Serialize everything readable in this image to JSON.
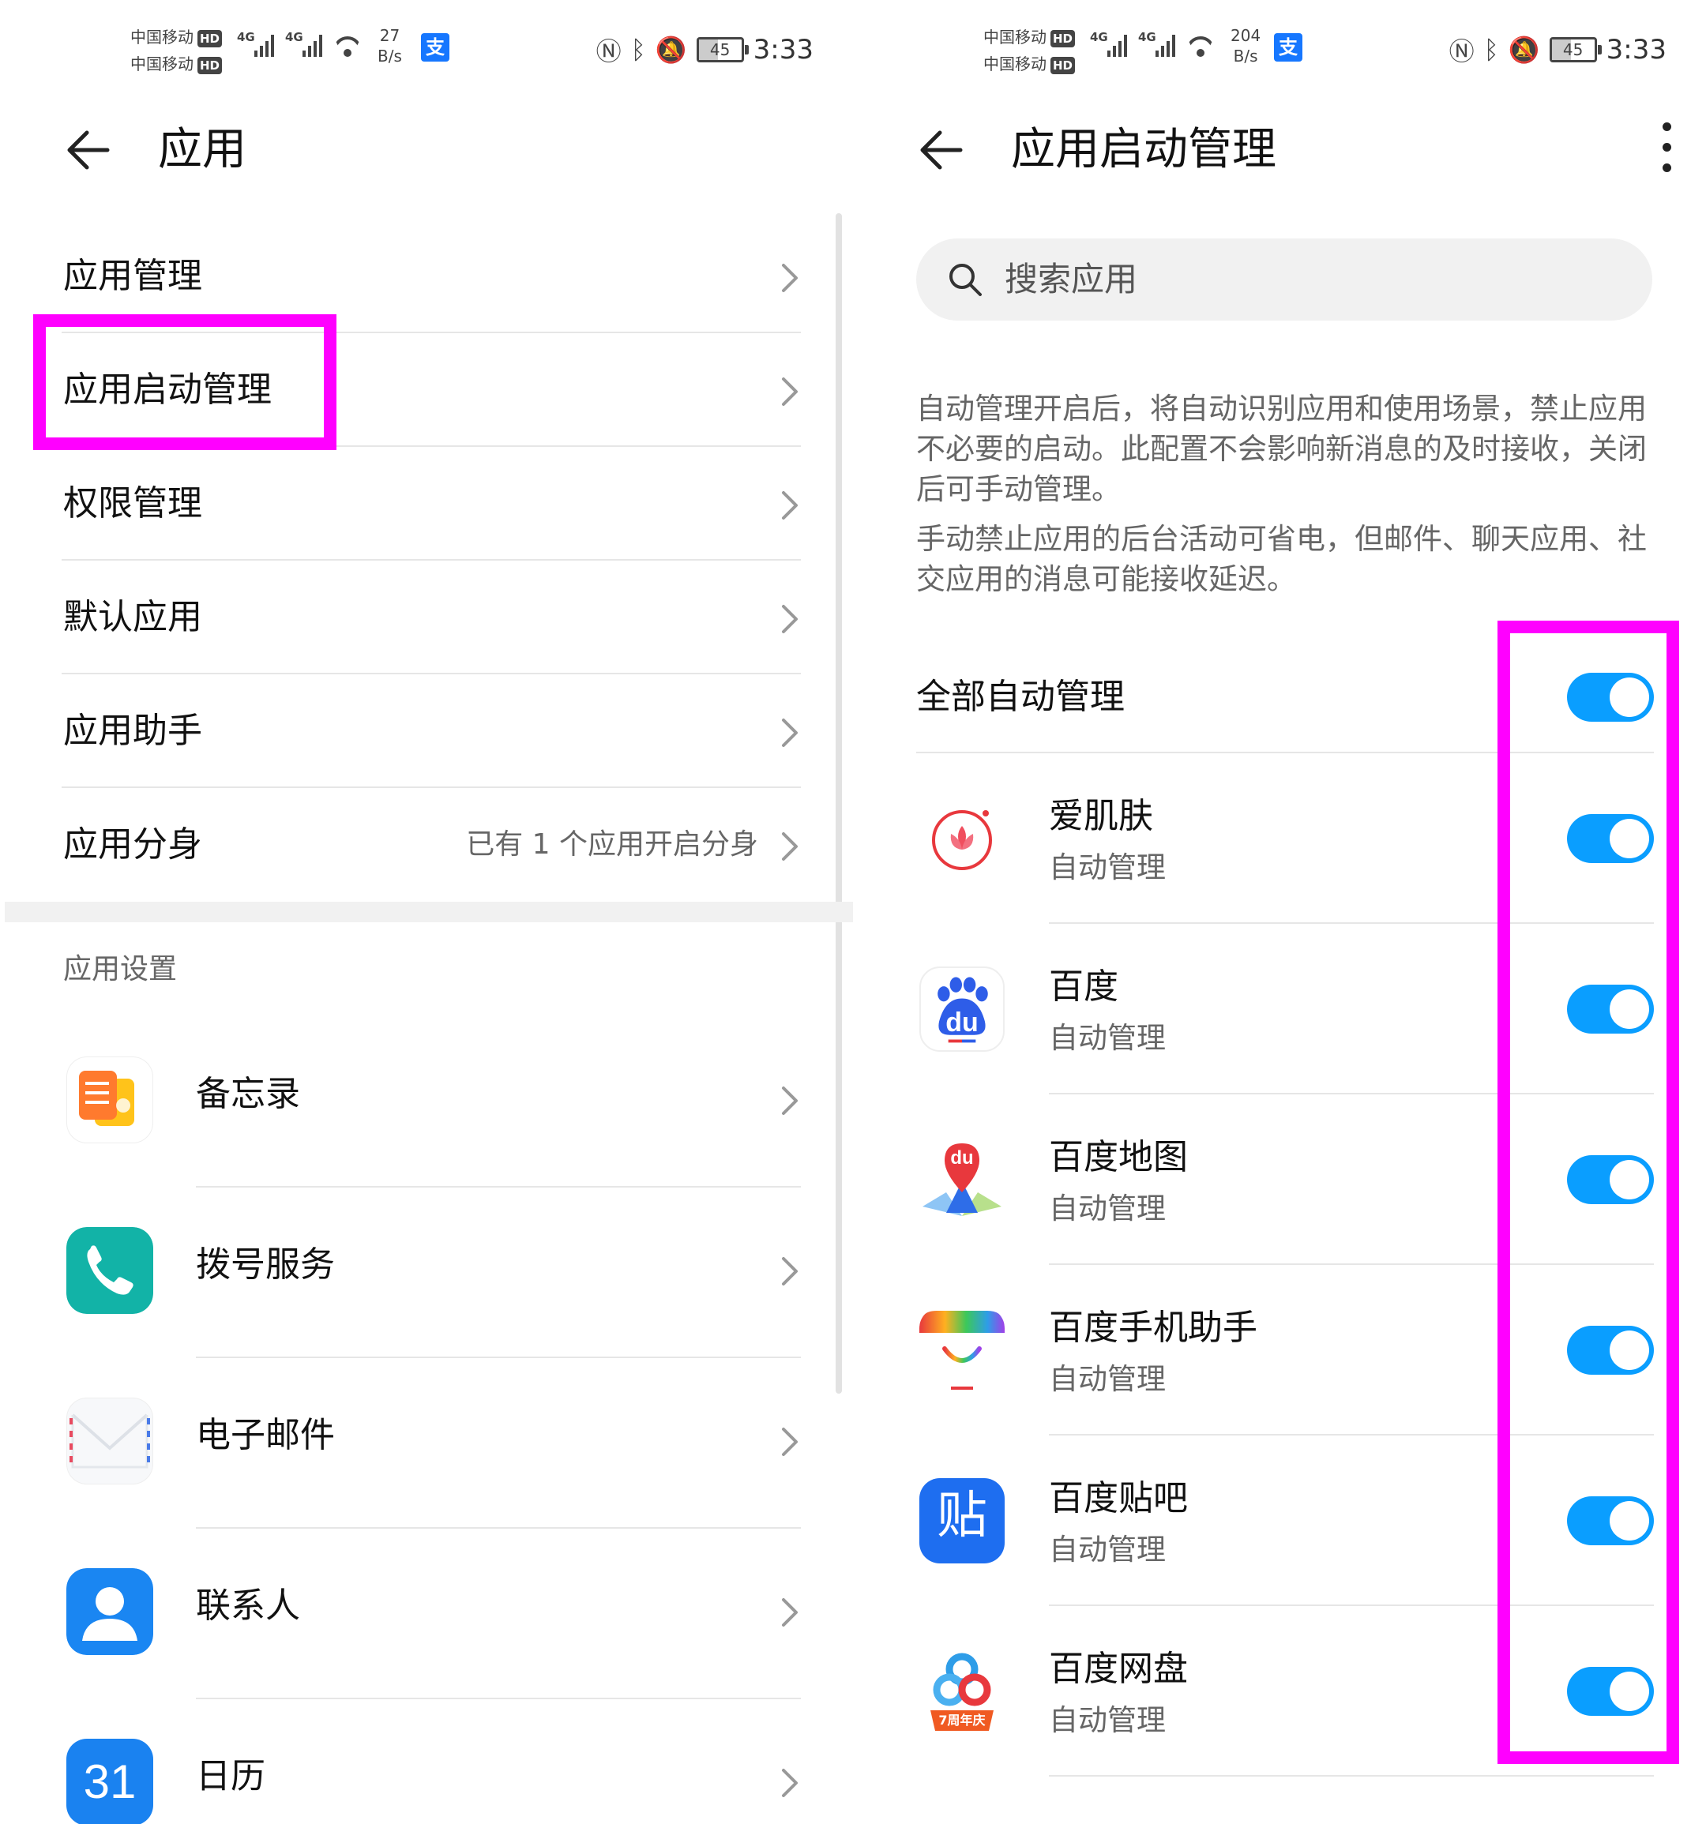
{
  "status_left": {
    "carrier1": "中国移动",
    "carrier2": "中国移动",
    "hd": "HD",
    "net_type": "4G",
    "speed_value": "27",
    "speed_unit": "B/s",
    "battery": "45",
    "time": "3:33"
  },
  "status_right": {
    "carrier1": "中国移动",
    "carrier2": "中国移动",
    "hd": "HD",
    "net_type": "4G",
    "speed_value": "204",
    "speed_unit": "B/s",
    "battery": "45",
    "time": "3:33"
  },
  "alipay_glyph": "支",
  "left_screen": {
    "title": "应用",
    "menu": [
      {
        "label": "应用管理",
        "value": ""
      },
      {
        "label": "应用启动管理",
        "value": ""
      },
      {
        "label": "权限管理",
        "value": ""
      },
      {
        "label": "默认应用",
        "value": ""
      },
      {
        "label": "应用助手",
        "value": ""
      },
      {
        "label": "应用分身",
        "value": "已有 1 个应用开启分身"
      }
    ],
    "section_label": "应用设置",
    "apps": [
      {
        "label": "备忘录",
        "icon": "memo-icon"
      },
      {
        "label": "拨号服务",
        "icon": "phone-icon"
      },
      {
        "label": "电子邮件",
        "icon": "email-icon"
      },
      {
        "label": "联系人",
        "icon": "contacts-icon"
      },
      {
        "label": "日历",
        "icon": "calendar-icon",
        "icon_text": "31"
      }
    ]
  },
  "right_screen": {
    "title": "应用启动管理",
    "search_placeholder": "搜索应用",
    "description_1": "自动管理开启后，将自动识别应用和使用场景，禁止应用不必要的启动。此配置不会影响新消息的及时接收，关闭后可手动管理。",
    "description_2": "手动禁止应用的后台活动可省电，但邮件、聊天应用、社交应用的消息可能接收延迟。",
    "all_auto_label": "全部自动管理",
    "all_auto_on": true,
    "apps": [
      {
        "name": "爱肌肤",
        "status": "自动管理",
        "on": true,
        "icon": "aijifu-icon"
      },
      {
        "name": "百度",
        "status": "自动管理",
        "on": true,
        "icon": "baidu-icon",
        "icon_text": "du"
      },
      {
        "name": "百度地图",
        "status": "自动管理",
        "on": true,
        "icon": "baidu-map-icon",
        "icon_text": "du"
      },
      {
        "name": "百度手机助手",
        "status": "自动管理",
        "on": true,
        "icon": "baidu-assistant-icon"
      },
      {
        "name": "百度贴吧",
        "status": "自动管理",
        "on": true,
        "icon": "baidu-tieba-icon",
        "icon_text": "贴"
      },
      {
        "name": "百度网盘",
        "status": "自动管理",
        "on": true,
        "icon": "baidu-netdisk-icon",
        "icon_text": "7周年庆"
      }
    ]
  },
  "colors": {
    "highlight": "#ff00ff",
    "toggle_on": "#0a9eff",
    "divider": "#e6e6e6"
  }
}
